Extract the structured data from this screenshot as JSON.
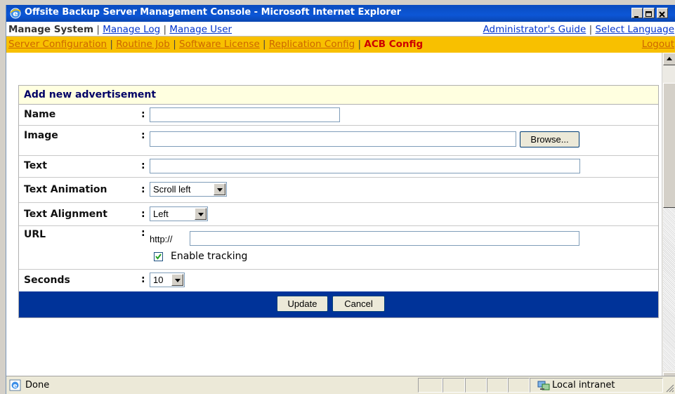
{
  "window": {
    "title": "Offsite Backup Server Management Console - Microsoft Internet Explorer"
  },
  "nav_top": {
    "current": "Manage System",
    "links": [
      "Manage Log",
      "Manage User"
    ],
    "right_links": [
      "Administrator's Guide",
      "Select Language"
    ]
  },
  "nav_sub": {
    "links": [
      "Server Configuration",
      "Routine Job",
      "Software License",
      "Replication Config"
    ],
    "current": "ACB Config",
    "logout": "Logout"
  },
  "form": {
    "title": "Add new advertisement",
    "fields": {
      "name": {
        "label": "Name",
        "value": ""
      },
      "image": {
        "label": "Image",
        "value": "",
        "browse_label": "Browse..."
      },
      "text": {
        "label": "Text",
        "value": ""
      },
      "text_animation": {
        "label": "Text Animation",
        "selected": "Scroll left"
      },
      "text_alignment": {
        "label": "Text Alignment",
        "selected": "Left"
      },
      "url": {
        "label": "URL",
        "prefix": "http://",
        "value": "",
        "tracking_label": "Enable tracking",
        "tracking_checked": true
      },
      "seconds": {
        "label": "Seconds",
        "selected": "10"
      }
    },
    "colon": ":",
    "update_label": "Update",
    "cancel_label": "Cancel"
  },
  "status": {
    "text": "Done",
    "zone": "Local intranet"
  },
  "colors": {
    "title_bar": "#0c56d6",
    "sub_nav": "#f8c000",
    "form_footer": "#003399",
    "form_header": "#ffffe0"
  }
}
